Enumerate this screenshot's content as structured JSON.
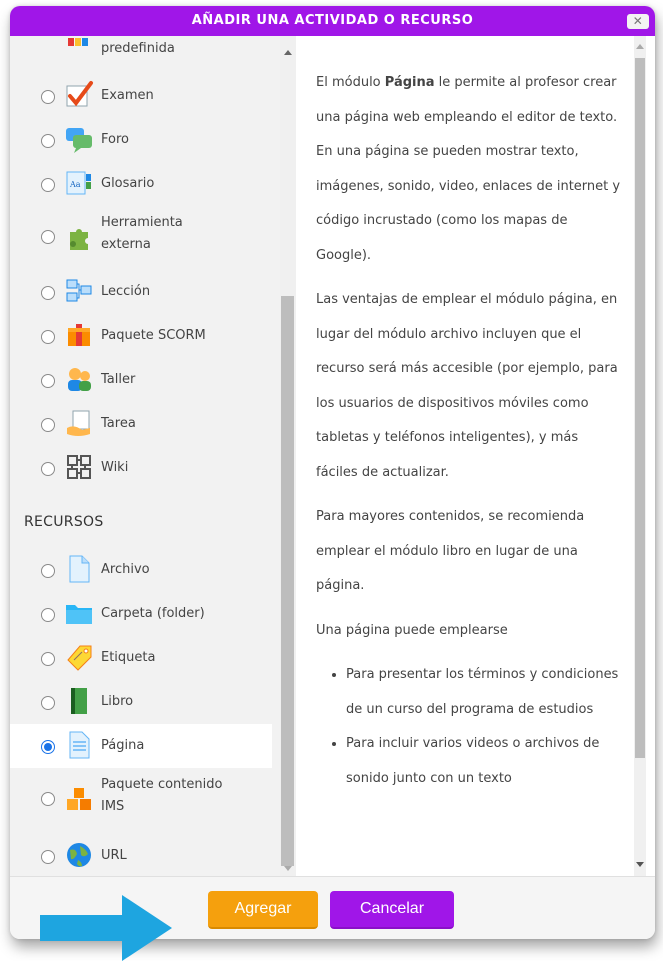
{
  "dialog": {
    "title": "AÑADIR UNA ACTIVIDAD O RECURSO",
    "close_glyph": "✕"
  },
  "activities": [
    {
      "label": "predefinida",
      "icon": "predefined-icon"
    },
    {
      "label": "Examen",
      "icon": "quiz-check-icon"
    },
    {
      "label": "Foro",
      "icon": "forum-icon"
    },
    {
      "label": "Glosario",
      "icon": "glossary-icon"
    },
    {
      "label": "Herramienta externa",
      "label_line1": "Herramienta",
      "label_line2": "externa",
      "icon": "puzzle-icon"
    },
    {
      "label": "Lección",
      "icon": "lesson-icon"
    },
    {
      "label": "Paquete SCORM",
      "icon": "scorm-icon"
    },
    {
      "label": "Taller",
      "icon": "workshop-icon"
    },
    {
      "label": "Tarea",
      "icon": "assignment-icon"
    },
    {
      "label": "Wiki",
      "icon": "wiki-icon"
    }
  ],
  "resources_heading": "RECURSOS",
  "resources": [
    {
      "label": "Archivo",
      "icon": "file-icon"
    },
    {
      "label": "Carpeta (folder)",
      "icon": "folder-icon"
    },
    {
      "label": "Etiqueta",
      "icon": "label-tag-icon"
    },
    {
      "label": "Libro",
      "icon": "book-icon"
    },
    {
      "label": "Página",
      "icon": "page-icon",
      "selected": true
    },
    {
      "label": "Paquete contenido IMS",
      "label_line1": "Paquete contenido",
      "label_line2": "IMS",
      "icon": "ims-icon"
    },
    {
      "label": "URL",
      "icon": "url-globe-icon"
    }
  ],
  "description": {
    "p1_a": "El módulo ",
    "p1_bold": "Página",
    "p1_b": " le permite al profesor crear una página web empleando el editor de texto. En una página se pueden mostrar texto, imágenes, sonido, video, enlaces de internet y código incrustado (como los mapas de Google).",
    "p2": "Las ventajas de emplear el módulo página, en lugar del módulo archivo incluyen que el recurso será más accesible (por ejemplo, para los usuarios de dispositivos móviles como tabletas y teléfonos inteligentes), y más fáciles de actualizar.",
    "p3": "Para mayores contenidos, se recomienda emplear el módulo libro en lugar de una página.",
    "p4": "Una página puede emplearse",
    "bullets": [
      "Para presentar los términos y condiciones de un curso del programa de estudios",
      "Para incluir varios videos o archivos de sonido junto con un texto"
    ]
  },
  "footer": {
    "add_label": "Agregar",
    "cancel_label": "Cancelar"
  },
  "colors": {
    "title_bar": "#a016e8",
    "add_button": "#f5a00d",
    "cancel_button": "#a016e8",
    "arrow": "#1ea5e0",
    "radio_selected": "#1a73e8"
  }
}
